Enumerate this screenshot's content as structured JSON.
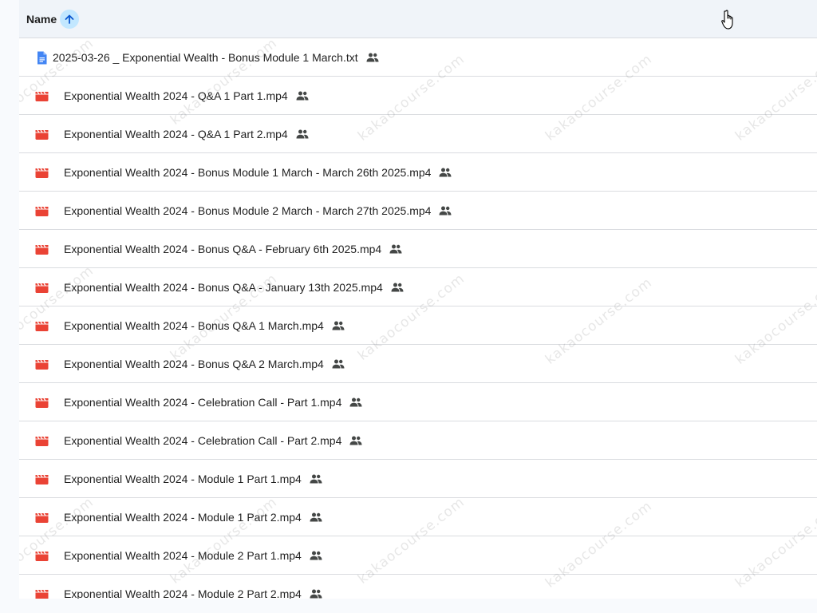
{
  "header": {
    "column_label": "Name",
    "sort_direction": "ascending",
    "sort_icon": "arrow-up-icon"
  },
  "colors": {
    "header_bg": "#f0f4f9",
    "sort_accent": "#c2e7ff",
    "video_icon": "#ea4335",
    "doc_icon": "#4285f4",
    "text": "#1f1f1f"
  },
  "files": [
    {
      "name": "2025-03-26 _ Exponential Wealth - Bonus Module 1 March.txt",
      "type": "document",
      "icon": "doc-icon",
      "shared": true
    },
    {
      "name": "Exponential Wealth 2024  - Q&A 1 Part 1.mp4",
      "type": "video",
      "icon": "video-icon",
      "shared": true
    },
    {
      "name": "Exponential Wealth 2024  - Q&A 1 Part 2.mp4",
      "type": "video",
      "icon": "video-icon",
      "shared": true
    },
    {
      "name": "Exponential Wealth 2024 - Bonus Module 1 March - March 26th 2025.mp4",
      "type": "video",
      "icon": "video-icon",
      "shared": true
    },
    {
      "name": "Exponential Wealth 2024 - Bonus Module 2 March - March 27th 2025.mp4",
      "type": "video",
      "icon": "video-icon",
      "shared": true
    },
    {
      "name": "Exponential Wealth 2024 - Bonus Q&A - February 6th 2025.mp4",
      "type": "video",
      "icon": "video-icon",
      "shared": true
    },
    {
      "name": "Exponential Wealth 2024 - Bonus Q&A - January 13th 2025.mp4",
      "type": "video",
      "icon": "video-icon",
      "shared": true
    },
    {
      "name": "Exponential Wealth 2024 - Bonus Q&A 1 March.mp4",
      "type": "video",
      "icon": "video-icon",
      "shared": true
    },
    {
      "name": "Exponential Wealth 2024 - Bonus Q&A 2 March.mp4",
      "type": "video",
      "icon": "video-icon",
      "shared": true
    },
    {
      "name": "Exponential Wealth 2024 - Celebration Call - Part 1.mp4",
      "type": "video",
      "icon": "video-icon",
      "shared": true
    },
    {
      "name": "Exponential Wealth 2024 - Celebration Call - Part 2.mp4",
      "type": "video",
      "icon": "video-icon",
      "shared": true
    },
    {
      "name": "Exponential Wealth 2024 - Module 1 Part 1.mp4",
      "type": "video",
      "icon": "video-icon",
      "shared": true
    },
    {
      "name": "Exponential Wealth 2024 - Module 1 Part 2.mp4",
      "type": "video",
      "icon": "video-icon",
      "shared": true
    },
    {
      "name": "Exponential Wealth 2024 - Module 2 Part 1.mp4",
      "type": "video",
      "icon": "video-icon",
      "shared": true
    },
    {
      "name": "Exponential Wealth 2024 - Module 2 Part 2.mp4",
      "type": "video",
      "icon": "video-icon",
      "shared": true
    }
  ],
  "watermark": {
    "text": "kakaocourse.com"
  }
}
